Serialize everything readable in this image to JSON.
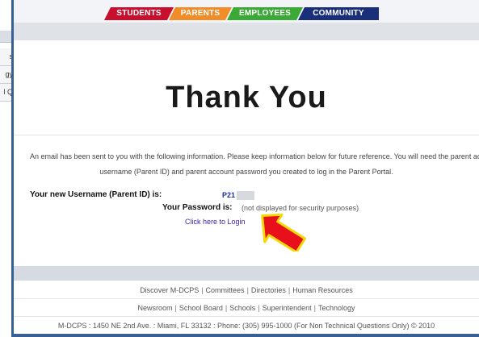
{
  "background_window": {
    "items": [
      "s",
      "gy",
      "l Q"
    ]
  },
  "nav": {
    "tabs": [
      "STUDENTS",
      "PARENTS",
      "EMPLOYEES",
      "COMMUNITY"
    ]
  },
  "main": {
    "heading": "Thank You",
    "email_message_line1": "An email has been sent to you with the following information. Please keep information below for future reference. You will need the parent account",
    "email_message_line2": "username (Parent ID) and parent account password you created to log in the Parent Portal.",
    "username_label": "Your new Username (Parent ID) is:",
    "username_value": "P21",
    "password_label": "Your Password is:",
    "password_note": "(not displayed for security purposes)",
    "login_link": "Click here to Login"
  },
  "footer": {
    "row1": [
      "Discover M-DCPS",
      "Committees",
      "Directories",
      "Human Resources"
    ],
    "row2": [
      "Newsroom",
      "School Board",
      "Schools",
      "Superintendent",
      "Technology"
    ],
    "address": "M-DCPS : 1450 NE 2nd Ave. : Miami, FL 33132 : Phone: (305) 995-1000 (For Non Technical Questions Only) © 2010"
  },
  "colors": {
    "students": "#c8102e",
    "parents": "#f28c28",
    "employees": "#3aa935",
    "community": "#1a2f7a",
    "arrow_fill": "#e8101a",
    "arrow_outline": "#f5d90a"
  },
  "icons": {
    "pointer_arrow": "red-arrow-icon"
  }
}
